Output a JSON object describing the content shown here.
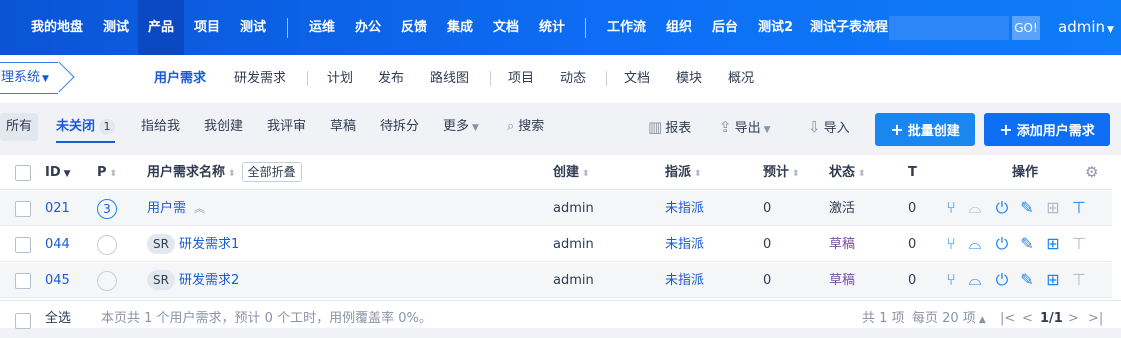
{
  "topnav": {
    "items": [
      "我的地盘",
      "测试",
      "产品",
      "项目",
      "测试",
      "运维",
      "办公",
      "反馈",
      "集成",
      "文档",
      "统计",
      "工作流",
      "组织",
      "后台",
      "测试2",
      "测试子表流程"
    ],
    "go_label": "GO!",
    "user": "admin"
  },
  "subnav": {
    "product": "理系统",
    "items": [
      "用户需求",
      "研发需求",
      "计划",
      "发布",
      "路线图",
      "项目",
      "动态",
      "文档",
      "模块",
      "概况"
    ]
  },
  "filters": {
    "all": "所有",
    "unclosed": "未关闭",
    "unclosed_count": "1",
    "items": [
      "指给我",
      "我创建",
      "我评审",
      "草稿",
      "待拆分"
    ],
    "more": "更多",
    "search": "搜索"
  },
  "tools": {
    "report": "报表",
    "export": "导出",
    "import": "导入",
    "batch_create": "批量创建",
    "add": "添加用户需求"
  },
  "table": {
    "headers": {
      "id": "ID",
      "pri": "P",
      "name": "用户需求名称",
      "fold_all": "全部折叠",
      "creator": "创建",
      "assigned": "指派",
      "estimate": "预计",
      "status": "状态",
      "t": "T",
      "actions": "操作"
    },
    "rows": [
      {
        "id": "021",
        "pri": "3",
        "tag": "",
        "name": "用户需",
        "creator": "admin",
        "assigned": "未指派",
        "estimate": "0",
        "status": "激活",
        "t": "0"
      },
      {
        "id": "044",
        "pri": "",
        "tag": "SR",
        "name": "研发需求1",
        "creator": "admin",
        "assigned": "未指派",
        "estimate": "0",
        "status": "草稿",
        "t": "0"
      },
      {
        "id": "045",
        "pri": "",
        "tag": "SR",
        "name": "研发需求2",
        "creator": "admin",
        "assigned": "未指派",
        "estimate": "0",
        "status": "草稿",
        "t": "0"
      }
    ]
  },
  "footer": {
    "select_all": "全选",
    "summary": "本页共 1 个用户需求，预计 0 个工时，用例覆盖率 0%。",
    "total": "共 1 项",
    "per_page": "每页 20 项",
    "page": "1/1"
  },
  "colors": {
    "accent": "#1a5bd6",
    "nav_bg": "#0d6ef5",
    "button": "#1a86f0"
  }
}
